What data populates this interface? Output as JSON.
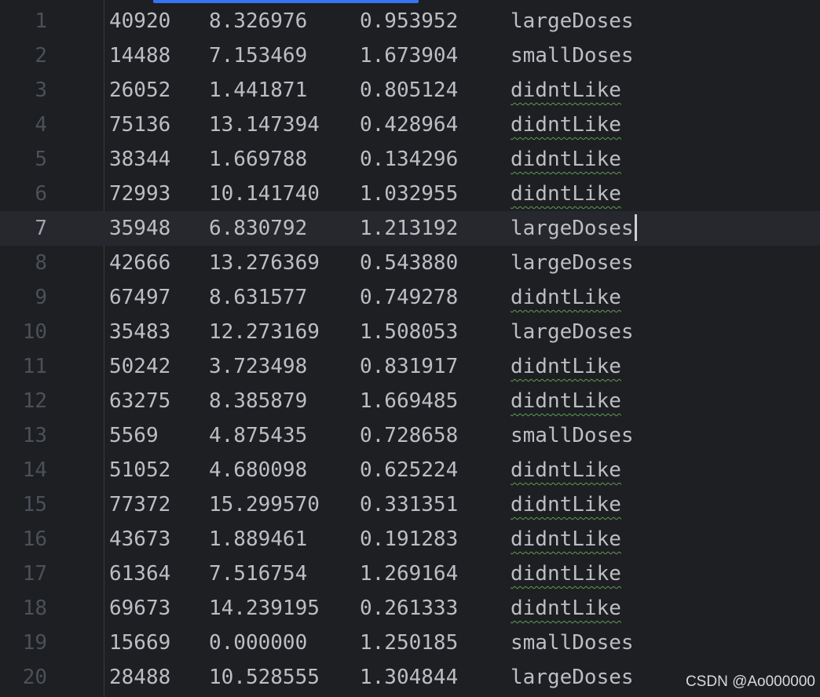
{
  "editor": {
    "current_line": 7,
    "rows": [
      {
        "num": "1",
        "c1": "40920",
        "c2": "8.326976",
        "c3": "0.953952",
        "c4": "largeDoses"
      },
      {
        "num": "2",
        "c1": "14488",
        "c2": "7.153469",
        "c3": "1.673904",
        "c4": "smallDoses"
      },
      {
        "num": "3",
        "c1": "26052",
        "c2": "1.441871",
        "c3": "0.805124",
        "c4": "didntLike"
      },
      {
        "num": "4",
        "c1": "75136",
        "c2": "13.147394",
        "c3": "0.428964",
        "c4": "didntLike"
      },
      {
        "num": "5",
        "c1": "38344",
        "c2": "1.669788",
        "c3": "0.134296",
        "c4": "didntLike"
      },
      {
        "num": "6",
        "c1": "72993",
        "c2": "10.141740",
        "c3": "1.032955",
        "c4": "didntLike"
      },
      {
        "num": "7",
        "c1": "35948",
        "c2": "6.830792",
        "c3": "1.213192",
        "c4": "largeDoses"
      },
      {
        "num": "8",
        "c1": "42666",
        "c2": "13.276369",
        "c3": "0.543880",
        "c4": "largeDoses"
      },
      {
        "num": "9",
        "c1": "67497",
        "c2": "8.631577",
        "c3": "0.749278",
        "c4": "didntLike"
      },
      {
        "num": "10",
        "c1": "35483",
        "c2": "12.273169",
        "c3": "1.508053",
        "c4": "largeDoses"
      },
      {
        "num": "11",
        "c1": "50242",
        "c2": "3.723498",
        "c3": "0.831917",
        "c4": "didntLike"
      },
      {
        "num": "12",
        "c1": "63275",
        "c2": "8.385879",
        "c3": "1.669485",
        "c4": "didntLike"
      },
      {
        "num": "13",
        "c1": "5569",
        "c2": "4.875435",
        "c3": "0.728658",
        "c4": "smallDoses"
      },
      {
        "num": "14",
        "c1": "51052",
        "c2": "4.680098",
        "c3": "0.625224",
        "c4": "didntLike"
      },
      {
        "num": "15",
        "c1": "77372",
        "c2": "15.299570",
        "c3": "0.331351",
        "c4": "didntLike"
      },
      {
        "num": "16",
        "c1": "43673",
        "c2": "1.889461",
        "c3": "0.191283",
        "c4": "didntLike"
      },
      {
        "num": "17",
        "c1": "61364",
        "c2": "7.516754",
        "c3": "1.269164",
        "c4": "didntLike"
      },
      {
        "num": "18",
        "c1": "69673",
        "c2": "14.239195",
        "c3": "0.261333",
        "c4": "didntLike"
      },
      {
        "num": "19",
        "c1": "15669",
        "c2": "0.000000",
        "c3": "1.250185",
        "c4": "smallDoses"
      },
      {
        "num": "20",
        "c1": "28488",
        "c2": "10.528555",
        "c3": "1.304844",
        "c4": "largeDoses"
      }
    ]
  },
  "watermark": "CSDN @Ao000000",
  "colors": {
    "background": "#1e1f22",
    "current_line": "#26282e",
    "text": "#bcbec4",
    "gutter_text": "#4b5059",
    "typo_underline": "#5e9c53",
    "tab_accent": "#3574f0"
  }
}
